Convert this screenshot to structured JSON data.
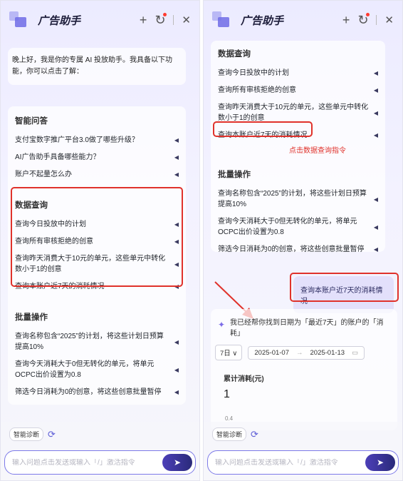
{
  "app_title": "广告助手",
  "header_icons": {
    "plus": "+",
    "history": "↻",
    "close": "✕"
  },
  "left": {
    "greeting": "晚上好，我是你的专属 AI 投放助手。我具备以下功能，你可以点击了解：",
    "sections": [
      {
        "title": "智能问答",
        "items": [
          "支付宝数字推广平台3.0做了哪些升级？",
          "AI广告助手具备哪些能力？",
          "账户不起量怎么办"
        ]
      },
      {
        "title": "数据查询",
        "items": [
          "查询今日投放中的计划",
          "查询所有审核拒绝的创意",
          "查询昨天消费大于10元的单元，这些单元中转化数小于1的创意",
          "查询本账户近7天的消耗情况"
        ]
      },
      {
        "title": "批量操作",
        "items": [
          "查询名称包含“2025”的计划，将这些计划日预算提高10%",
          "查询今天消耗大于0但无转化的单元，将单元OCPC出价设置为0.8",
          "筛选今日消耗为0的创意，将这些创意批量暂停"
        ]
      }
    ]
  },
  "right": {
    "sections": [
      {
        "title": "数据查询",
        "items": [
          "查询今日投放中的计划",
          "查询所有审核拒绝的创意",
          "查询昨天消费大于10元的单元，这些单元中转化数小于1的创意",
          "查询本账户近7天的消耗情况"
        ]
      },
      {
        "title": "批量操作",
        "items": [
          "查询名称包含“2025”的计划，将这些计划日预算提高10%",
          "查询今天消耗大于0但无转化的单元，将单元OCPC出价设置为0.8",
          "筛选今日消耗为0的创意，将这些创意批量暂停"
        ]
      }
    ],
    "annotation": "点击数据查询指令",
    "user_message": "查询本账户近7天的消耗情况",
    "reply": "我已经帮你找到日期为「最近7天」的账户的「消耗」",
    "period": "7日 ∨",
    "date_start": "2025-01-07",
    "date_arrow": "→",
    "date_end": "2025-01-13",
    "metric_label": "累计消耗(元)",
    "metric_value": "1",
    "axis_tick": "0.4"
  },
  "bottom": {
    "diag_label": "智能诊断",
    "placeholder": "输入问题点击发送或输入「/」激活指令"
  },
  "colors": {
    "accent": "#5b5bd6",
    "highlight": "#e0322b",
    "bubble": "#e3e0fb"
  }
}
